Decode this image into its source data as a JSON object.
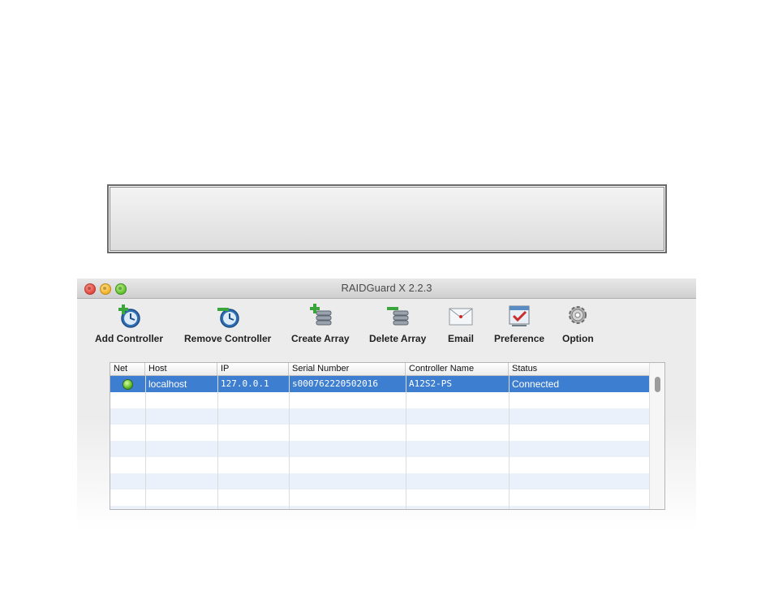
{
  "window": {
    "title": "RAIDGuard X 2.2.3"
  },
  "toolbar": [
    {
      "label": "Add Controller",
      "icon": "add-controller-icon"
    },
    {
      "label": "Remove Controller",
      "icon": "remove-controller-icon"
    },
    {
      "label": "Create Array",
      "icon": "create-array-icon"
    },
    {
      "label": "Delete Array",
      "icon": "delete-array-icon"
    },
    {
      "label": "Email",
      "icon": "email-icon"
    },
    {
      "label": "Preference",
      "icon": "preference-icon"
    },
    {
      "label": "Option",
      "icon": "option-gear-icon"
    }
  ],
  "table": {
    "columns": [
      "Net",
      "Host",
      "IP",
      "Serial Number",
      "Controller Name",
      "Status"
    ],
    "rows": [
      {
        "net": "green-status-light",
        "host": "localhost",
        "ip": "127.0.0.1",
        "serial": "s000762220502016",
        "controller": "A12S2-PS",
        "status": "Connected"
      }
    ]
  },
  "colors": {
    "selection": "#3e7ed0",
    "alt_row": "#eaf1fb",
    "status_green": "#58b322"
  }
}
